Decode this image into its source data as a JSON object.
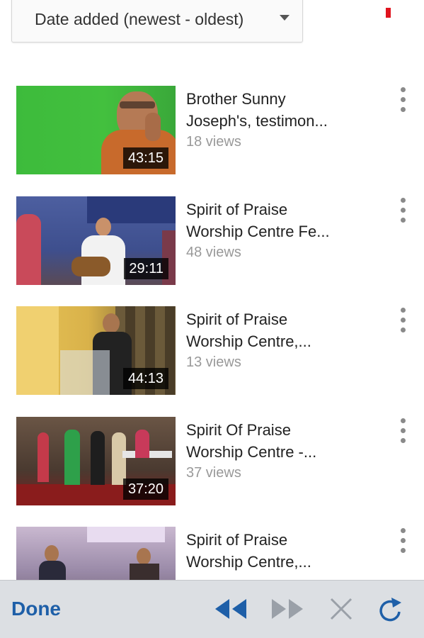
{
  "sort": {
    "label": "Date added (newest - oldest)"
  },
  "videos": [
    {
      "title_line1": "Brother Sunny",
      "title_line2": "Joseph's, testimon...",
      "views": "18 views",
      "duration": "43:15"
    },
    {
      "title_line1": "Spirit of Praise",
      "title_line2": "Worship Centre Fe...",
      "views": "48 views",
      "duration": "29:11"
    },
    {
      "title_line1": "Spirit of Praise",
      "title_line2": "Worship Centre,...",
      "views": "13 views",
      "duration": "44:13"
    },
    {
      "title_line1": "Spirit Of Praise",
      "title_line2": "Worship Centre -...",
      "views": "37 views",
      "duration": "37:20"
    },
    {
      "title_line1": "Spirit of Praise",
      "title_line2": "Worship Centre,...",
      "views": "",
      "duration": ""
    }
  ],
  "toolbar": {
    "done_label": "Done",
    "icons": [
      "rewind-icon",
      "fast-forward-icon",
      "close-icon",
      "refresh-icon"
    ]
  },
  "colors": {
    "accent": "#1e5fa8",
    "status_red": "#e0141e",
    "toolbar_bg": "#dcdfe3"
  }
}
